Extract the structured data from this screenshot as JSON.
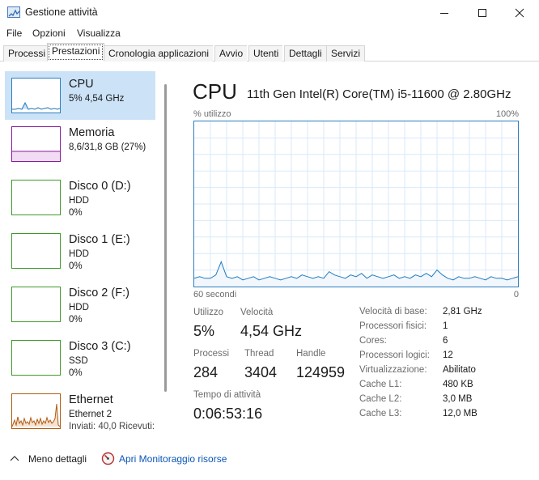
{
  "window": {
    "title": "Gestione attività",
    "icon": "task-manager-icon"
  },
  "menu": [
    "File",
    "Opzioni",
    "Visualizza"
  ],
  "tabs": [
    "Processi",
    "Prestazioni",
    "Cronologia applicazioni",
    "Avvio",
    "Utenti",
    "Dettagli",
    "Servizi"
  ],
  "active_tab": "Prestazioni",
  "sidebar": {
    "items": [
      {
        "name": "CPU",
        "line1": "5% 4,54 GHz",
        "line2": "",
        "line3": "",
        "color": "#1f7bc1",
        "selected": true
      },
      {
        "name": "Memoria",
        "line1": "8,6/31,8 GB (27%)",
        "line2": "",
        "line3": "",
        "color": "#8b1a9e",
        "selected": false
      },
      {
        "name": "Disco 0 (D:)",
        "line1": "HDD",
        "line2": "0%",
        "line3": "",
        "color": "#3d9a2a",
        "selected": false
      },
      {
        "name": "Disco 1 (E:)",
        "line1": "HDD",
        "line2": "0%",
        "line3": "",
        "color": "#3d9a2a",
        "selected": false
      },
      {
        "name": "Disco 2 (F:)",
        "line1": "HDD",
        "line2": "0%",
        "line3": "",
        "color": "#3d9a2a",
        "selected": false
      },
      {
        "name": "Disco 3 (C:)",
        "line1": "SSD",
        "line2": "0%",
        "line3": "",
        "color": "#3d9a2a",
        "selected": false
      },
      {
        "name": "Ethernet",
        "line1": "Ethernet 2",
        "line2": "Inviati: 40,0  Ricevuti:",
        "line3": "",
        "color": "#b05a10",
        "selected": false
      }
    ]
  },
  "detail": {
    "title": "CPU",
    "processor": "11th Gen Intel(R) Core(TM) i5-11600 @ 2.80GHz",
    "chart": {
      "y_label": "% utilizzo",
      "y_max_label": "100%",
      "x_label": "60 secondi",
      "x_end_label": "0"
    },
    "stats": {
      "utilization_label": "Utilizzo",
      "utilization": "5%",
      "speed_label": "Velocità",
      "speed": "4,54 GHz",
      "processes_label": "Processi",
      "processes": "284",
      "threads_label": "Thread",
      "threads": "3404",
      "handles_label": "Handle",
      "handles": "124959",
      "uptime_label": "Tempo di attività",
      "uptime": "0:06:53:16"
    },
    "specs": [
      {
        "key": "Velocità di base:",
        "value": "2,81 GHz"
      },
      {
        "key": "Processori fisici:",
        "value": "1"
      },
      {
        "key": "Cores:",
        "value": "6"
      },
      {
        "key": "Processori logici:",
        "value": "12"
      },
      {
        "key": "Virtualizzazione:",
        "value": "Abilitato"
      },
      {
        "key": "Cache L1:",
        "value": "480 KB"
      },
      {
        "key": "Cache L2:",
        "value": "3,0 MB"
      },
      {
        "key": "Cache L3:",
        "value": "12,0 MB"
      }
    ]
  },
  "footer": {
    "less_details": "Meno dettagli",
    "resource_monitor": "Apri Monitoraggio risorse"
  },
  "chart_data": {
    "type": "area",
    "x": [
      60,
      59,
      58,
      57,
      56,
      55,
      54,
      53,
      52,
      51,
      50,
      49,
      48,
      47,
      46,
      45,
      44,
      43,
      42,
      41,
      40,
      39,
      38,
      37,
      36,
      35,
      34,
      33,
      32,
      31,
      30,
      29,
      28,
      27,
      26,
      25,
      24,
      23,
      22,
      21,
      20,
      19,
      18,
      17,
      16,
      15,
      14,
      13,
      12,
      11,
      10,
      9,
      8,
      7,
      6,
      5,
      4,
      3,
      2,
      1,
      0
    ],
    "values": [
      5,
      6,
      5,
      5,
      7,
      15,
      6,
      5,
      6,
      4,
      5,
      6,
      4,
      5,
      6,
      5,
      4,
      5,
      6,
      5,
      7,
      6,
      5,
      6,
      5,
      9,
      7,
      6,
      5,
      7,
      6,
      8,
      5,
      7,
      6,
      5,
      6,
      7,
      5,
      6,
      5,
      7,
      6,
      8,
      6,
      10,
      7,
      5,
      4,
      6,
      5,
      5,
      6,
      5,
      4,
      6,
      5,
      5,
      4,
      5,
      6
    ],
    "xlim": [
      60,
      0
    ],
    "ylim": [
      0,
      100
    ],
    "grid": true
  }
}
